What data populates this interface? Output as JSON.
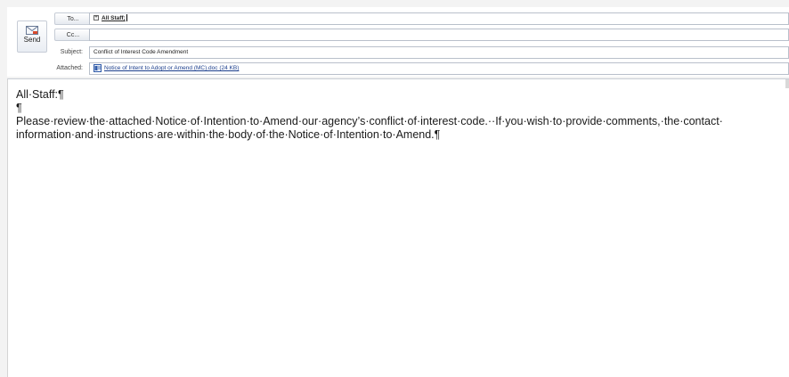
{
  "compose": {
    "send_label": "Send",
    "to_button": "To...",
    "cc_button": "Cc...",
    "subject_label": "Subject:",
    "attached_label": "Attached:",
    "to_value": "All Staff;",
    "cc_value": "",
    "subject_value": "Conflict of Interest Code Amendment",
    "attachment_name": "Notice of Intent to Adopt or Amend (MC).doc (24 KB)"
  },
  "body": {
    "greeting": "All·Staff:¶",
    "blank": "¶",
    "line1": "Please·review·the·attached·Notice·of·Intention·to·Amend·our·agency’s·conflict·of·interest·code.··If·you·wish·to·provide·comments,·the·contact·",
    "line2": "information·and·instructions·are·within·the·body·of·the·Notice·of·Intention·to·Amend.¶"
  },
  "icons": {
    "send": "send-envelope-icon",
    "expand": "expand-plus-icon",
    "attachment": "word-document-icon"
  },
  "colors": {
    "link": "#1a3d8c",
    "field_border": "#b9c0cb"
  }
}
